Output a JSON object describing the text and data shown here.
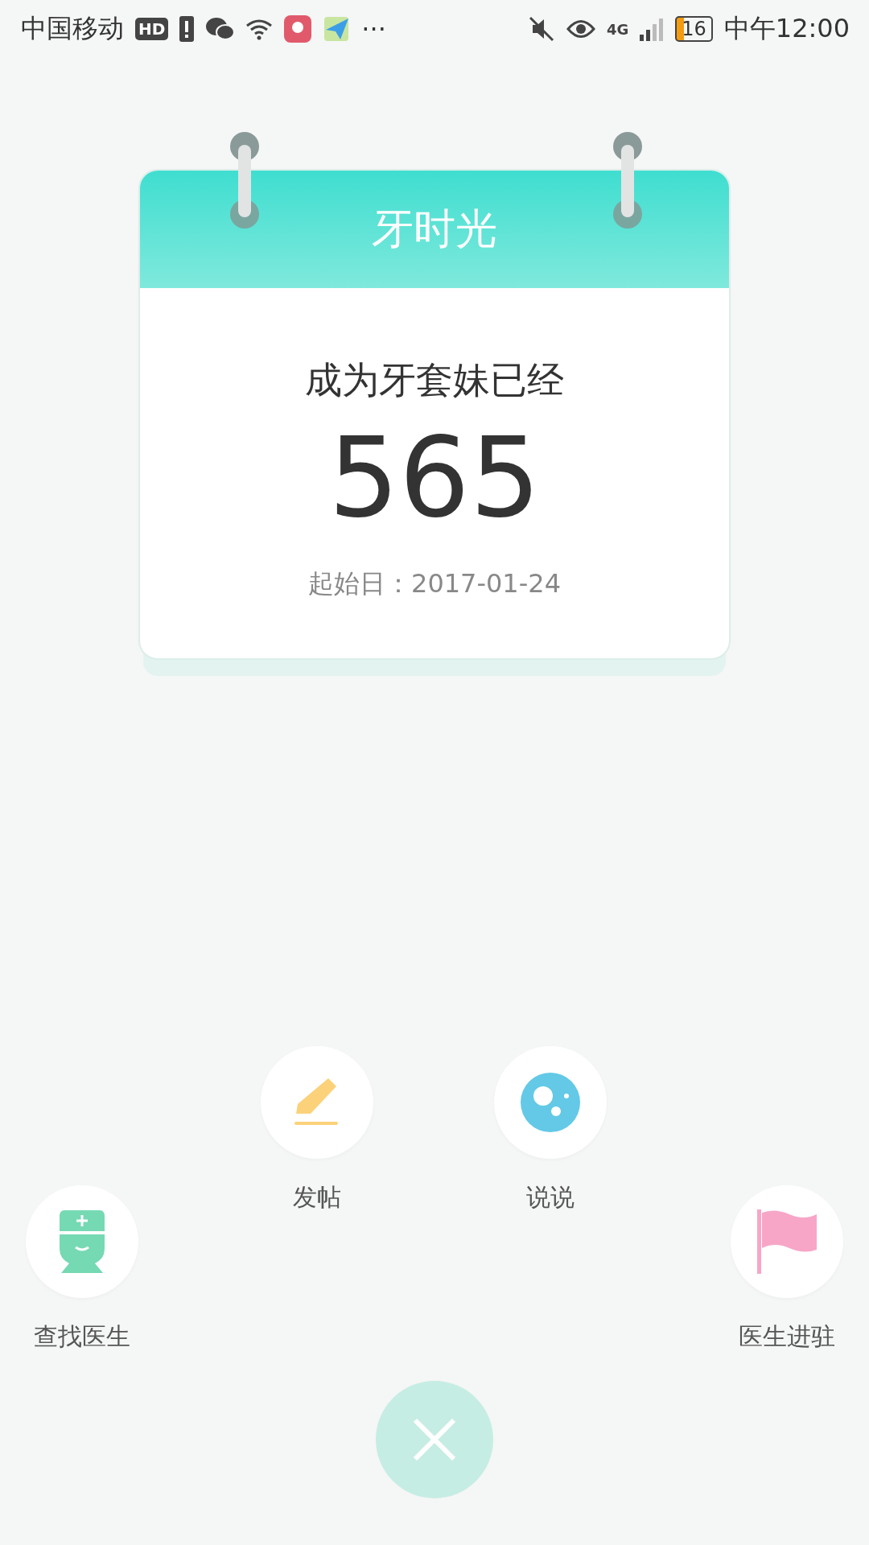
{
  "status_bar": {
    "carrier": "中国移动",
    "hd_badge": "HD",
    "more": "···",
    "network": "4G",
    "battery": "16",
    "time": "中午12:00"
  },
  "calendar": {
    "title": "牙时光",
    "caption": "成为牙套妹已经",
    "days": "565",
    "start": "起始日：2017-01-24"
  },
  "actions": [
    {
      "kind": "post",
      "label": "发帖"
    },
    {
      "kind": "talk",
      "label": "说说"
    },
    {
      "kind": "doctor",
      "label": "查找医生"
    },
    {
      "kind": "join",
      "label": "医生进驻"
    }
  ]
}
